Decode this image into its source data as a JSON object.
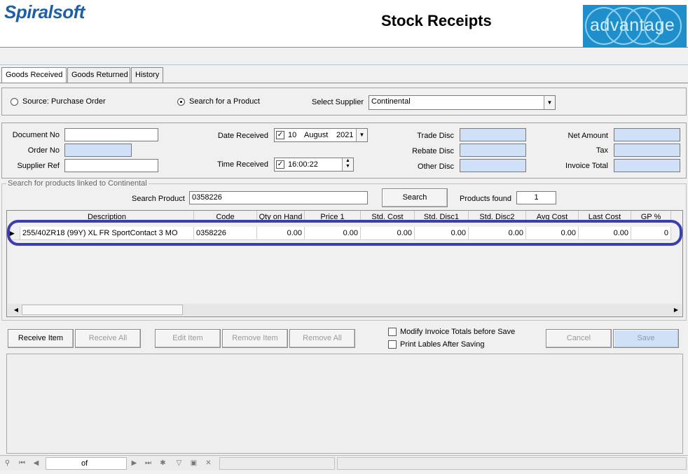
{
  "header": {
    "logo": "Spiralsoft",
    "title": "Stock Receipts",
    "brand_logo": "advantage"
  },
  "tabs": [
    "Goods Received",
    "Goods Returned",
    "History"
  ],
  "source": {
    "option_purchase_order": "Source: Purchase Order",
    "option_search_product": "Search for a Product",
    "selected": "Search for a Product",
    "supplier_label": "Select Supplier",
    "supplier_value": "Continental"
  },
  "form": {
    "document_no_label": "Document No",
    "document_no": "",
    "order_no_label": "Order No",
    "order_no": "",
    "supplier_ref_label": "Supplier Ref",
    "supplier_ref": "",
    "date_received_label": "Date Received",
    "date_received_day": "10",
    "date_received_month": "August",
    "date_received_year": "2021",
    "time_received_label": "Time Received",
    "time_received": "16:00:22",
    "trade_disc_label": "Trade Disc",
    "rebate_disc_label": "Rebate Disc",
    "other_disc_label": "Other Disc",
    "net_amount_label": "Net Amount",
    "tax_label": "Tax",
    "invoice_total_label": "Invoice Total"
  },
  "search": {
    "group_title": "Search for products linked to Continental",
    "product_label": "Search Product",
    "product_value": "0358226",
    "button": "Search",
    "found_label": "Products found",
    "found_count": "1"
  },
  "grid": {
    "columns": [
      "Description",
      "Code",
      "Qty on Hand",
      "Price 1",
      "Std. Cost",
      "Std. Disc1",
      "Std. Disc2",
      "Avg Cost",
      "Last Cost",
      "GP %"
    ],
    "rows": [
      [
        "255/40ZR18 (99Y) XL FR SportContact 3 MO",
        "0358226",
        "0.00",
        "0.00",
        "0.00",
        "0.00",
        "0.00",
        "0.00",
        "0.00",
        "0"
      ]
    ]
  },
  "actions": {
    "receive_item": "Receive Item",
    "receive_all": "Receive All",
    "edit_item": "Edit Item",
    "remove_item": "Remove Item",
    "remove_all": "Remove All",
    "modify_totals": "Modify Invoice Totals before Save",
    "print_labels": "Print Lables After Saving",
    "cancel": "Cancel",
    "save": "Save"
  },
  "navigator": {
    "of_label": "of"
  },
  "colors": {
    "accent_blue": "#cfe0f7",
    "logo_blue": "#1f5fa7",
    "highlight": "#3a3fb0"
  }
}
